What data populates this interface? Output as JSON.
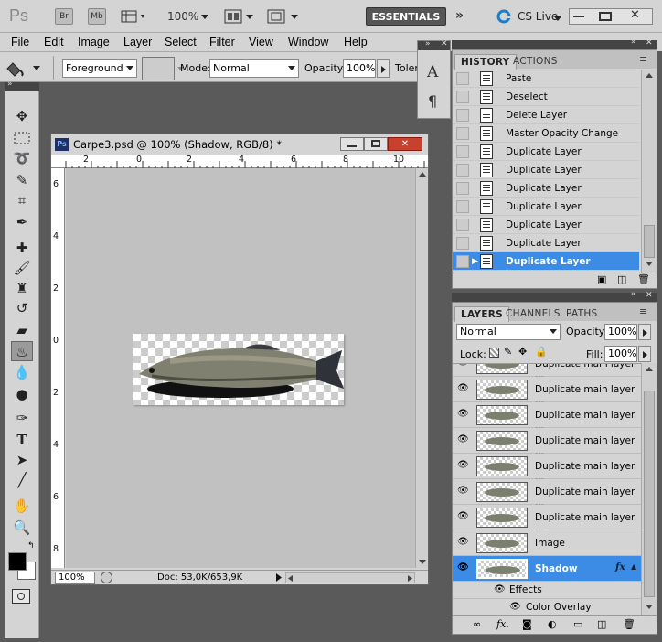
{
  "app": {
    "logo": "Ps",
    "bridge_label": "Br",
    "minibridge_label": "Mb",
    "zoom": "100%",
    "workspace": "ESSENTIALS",
    "cslive": "CS Live"
  },
  "menu": [
    "File",
    "Edit",
    "Image",
    "Layer",
    "Select",
    "Filter",
    "View",
    "Window",
    "Help"
  ],
  "options": {
    "fill_source": "Foreground",
    "mode_label": "Mode:",
    "mode_value": "Normal",
    "opacity_label": "Opacity:",
    "opacity_value": "100%",
    "tolerance_label": "Toler"
  },
  "document": {
    "title": "Carpe3.psd @ 100% (Shadow, RGB/8) *",
    "ps_badge": "Ps",
    "zoom": "100%",
    "doc_info": "Doc: 53,0K/653,9K",
    "hruler": [
      "2",
      "0",
      "2",
      "4",
      "6",
      "8",
      "10"
    ],
    "vruler": [
      "6",
      "4",
      "2",
      "0",
      "2",
      "4",
      "6",
      "8"
    ]
  },
  "history": {
    "tabs": [
      "HISTORY",
      "ACTIONS"
    ],
    "items": [
      "Paste",
      "Deselect",
      "Delete Layer",
      "Master Opacity Change",
      "Duplicate Layer",
      "Duplicate Layer",
      "Duplicate Layer",
      "Duplicate Layer",
      "Duplicate Layer",
      "Duplicate Layer",
      "Duplicate Layer"
    ]
  },
  "layers": {
    "tabs": [
      "LAYERS",
      "CHANNELS",
      "PATHS"
    ],
    "blend": "Normal",
    "opacity_label": "Opacity:",
    "opacity_value": "100%",
    "lock_label": "Lock:",
    "fill_label": "Fill:",
    "fill_value": "100%",
    "partial_top": "Duplicate main layer ...",
    "items": [
      "Duplicate main layer ...",
      "Duplicate main layer ...",
      "Duplicate main layer ...",
      "Duplicate main layer ...",
      "Duplicate main layer ...",
      "Duplicate main layer ...",
      "Image",
      "Shadow"
    ],
    "fx": "fx",
    "effects": "Effects",
    "color_overlay": "Color Overlay"
  },
  "colors": {
    "selection": "#3c8ce6",
    "ui_bg": "#d4d4d4",
    "workspace_bg": "#5a5a5a"
  }
}
